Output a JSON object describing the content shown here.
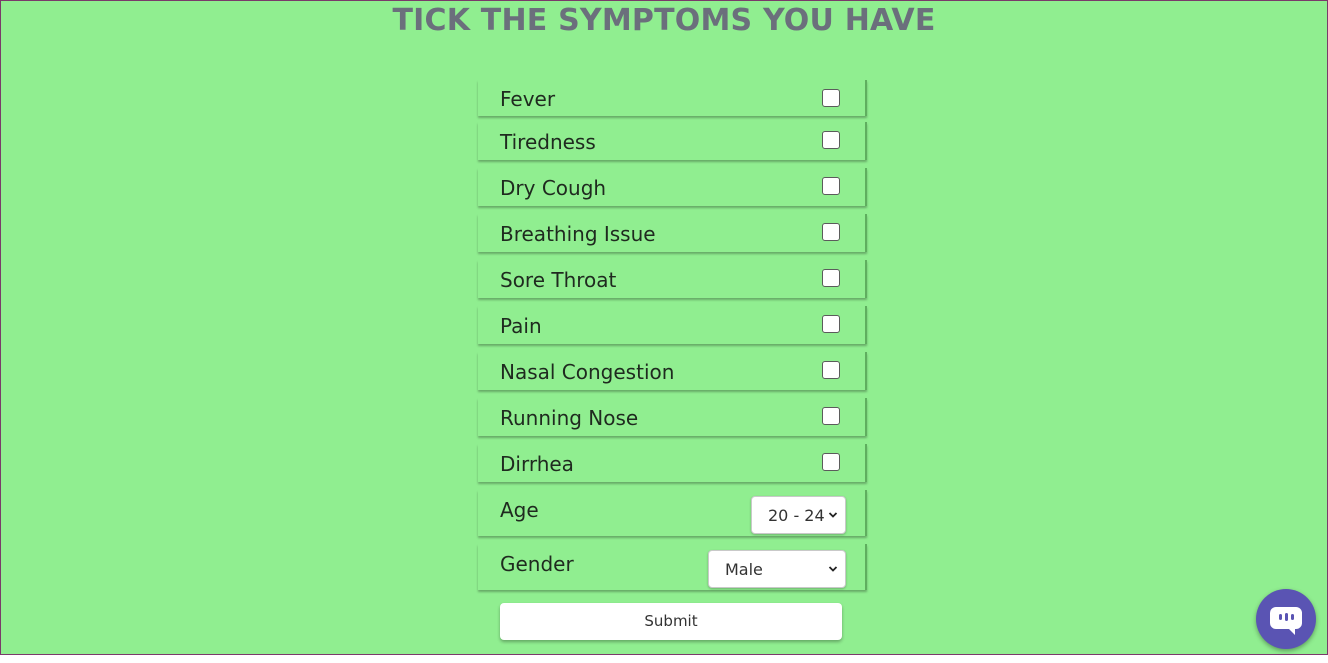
{
  "page": {
    "title": "TICK THE SYMPTOMS YOU HAVE",
    "background_color": "#90ee90",
    "title_color": "#6b6f7c"
  },
  "symptoms": [
    {
      "label": "Fever",
      "checked": false
    },
    {
      "label": "Tiredness",
      "checked": false
    },
    {
      "label": "Dry Cough",
      "checked": false
    },
    {
      "label": "Breathing Issue",
      "checked": false
    },
    {
      "label": "Sore Throat",
      "checked": false
    },
    {
      "label": "Pain",
      "checked": false
    },
    {
      "label": "Nasal Congestion",
      "checked": false
    },
    {
      "label": "Running Nose",
      "checked": false
    },
    {
      "label": "Dirrhea",
      "checked": false
    }
  ],
  "age": {
    "label": "Age",
    "selected": "20 - 24"
  },
  "gender": {
    "label": "Gender",
    "selected": "Male"
  },
  "submit_label": "Submit",
  "chat_widget": {
    "icon": "chat-bubble-icon",
    "color": "#5a54b3"
  }
}
